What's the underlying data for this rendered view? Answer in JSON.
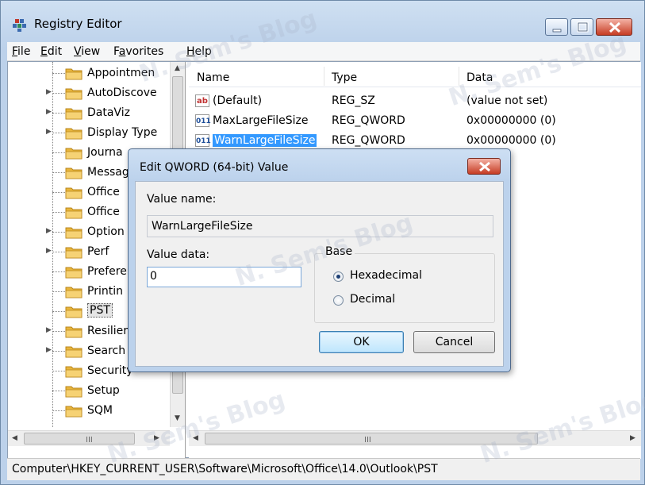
{
  "window": {
    "title": "Registry Editor"
  },
  "menu": {
    "file": {
      "mnemonic": "F",
      "rest": "ile"
    },
    "edit": {
      "mnemonic": "E",
      "rest": "dit"
    },
    "view": {
      "mnemonic": "V",
      "rest": "iew"
    },
    "favorites": {
      "pre": "F",
      "mnemonic": "a",
      "rest": "vorites"
    },
    "help": {
      "mnemonic": "H",
      "rest": "elp"
    }
  },
  "tree": {
    "items": [
      {
        "label": "Appointmen",
        "expandable": false
      },
      {
        "label": "AutoDiscove",
        "expandable": true
      },
      {
        "label": "DataViz",
        "expandable": true
      },
      {
        "label": "Display Type",
        "expandable": true
      },
      {
        "label": "Journa",
        "expandable": false
      },
      {
        "label": "Messag",
        "expandable": false
      },
      {
        "label": "Office",
        "expandable": false
      },
      {
        "label": "Office",
        "expandable": false
      },
      {
        "label": "Option",
        "expandable": true
      },
      {
        "label": "Perf",
        "expandable": true
      },
      {
        "label": "Prefere",
        "expandable": false
      },
      {
        "label": "Printin",
        "expandable": false
      },
      {
        "label": "PST",
        "expandable": false,
        "selected": true
      },
      {
        "label": "Resilier",
        "expandable": true
      },
      {
        "label": "Search",
        "expandable": true
      },
      {
        "label": "Security",
        "expandable": false
      },
      {
        "label": "Setup",
        "expandable": false
      },
      {
        "label": "SQM",
        "expandable": false
      }
    ]
  },
  "list": {
    "columns": {
      "name": "Name",
      "type": "Type",
      "data": "Data"
    },
    "rows": [
      {
        "icon": "ab",
        "name": "(Default)",
        "type": "REG_SZ",
        "data": "(value not set)"
      },
      {
        "icon": "011",
        "name": "MaxLargeFileSize",
        "type": "REG_QWORD",
        "data": "0x00000000 (0)"
      },
      {
        "icon": "011",
        "name": "WarnLargeFileSize",
        "type": "REG_QWORD",
        "data": "0x00000000 (0)"
      }
    ]
  },
  "status": {
    "path": "Computer\\HKEY_CURRENT_USER\\Software\\Microsoft\\Office\\14.0\\Outlook\\PST"
  },
  "dialog": {
    "title": "Edit QWORD (64-bit) Value",
    "value_name_label": "Value name:",
    "value_name": "WarnLargeFileSize",
    "value_data_label": "Value data:",
    "value_data": "0",
    "base_label": "Base",
    "hex_label": "Hexadecimal",
    "dec_label": "Decimal",
    "base_selected": "Hexadecimal",
    "ok_label": "OK",
    "cancel_label": "Cancel"
  },
  "scroll_glyphs": {
    "left": "◀",
    "right": "▶",
    "up": "▲",
    "down": "▼",
    "grip": "III"
  },
  "watermark": "N. Sem's Blog"
}
